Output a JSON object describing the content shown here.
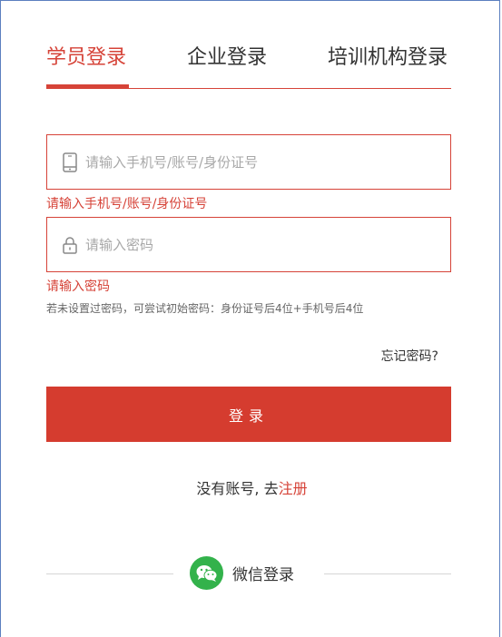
{
  "tabs": [
    {
      "label": "学员登录",
      "active": true
    },
    {
      "label": "企业登录",
      "active": false
    },
    {
      "label": "培训机构登录",
      "active": false
    }
  ],
  "account": {
    "placeholder": "请输入手机号/账号/身份证号",
    "value": "",
    "error": "请输入手机号/账号/身份证号",
    "icon": "phone-icon"
  },
  "password": {
    "placeholder": "请输入密码",
    "value": "",
    "error": "请输入密码",
    "icon": "lock-icon"
  },
  "hint": "若未设置过密码，可尝试初始密码：身份证号后4位+手机号后4位",
  "forgot_label": "忘记密码?",
  "login_label": "登录",
  "register": {
    "prefix": "没有账号, 去",
    "link": "注册"
  },
  "wechat_label": "微信登录",
  "colors": {
    "accent": "#d64338",
    "button": "#d53c2f",
    "wechat": "#33b24b"
  }
}
